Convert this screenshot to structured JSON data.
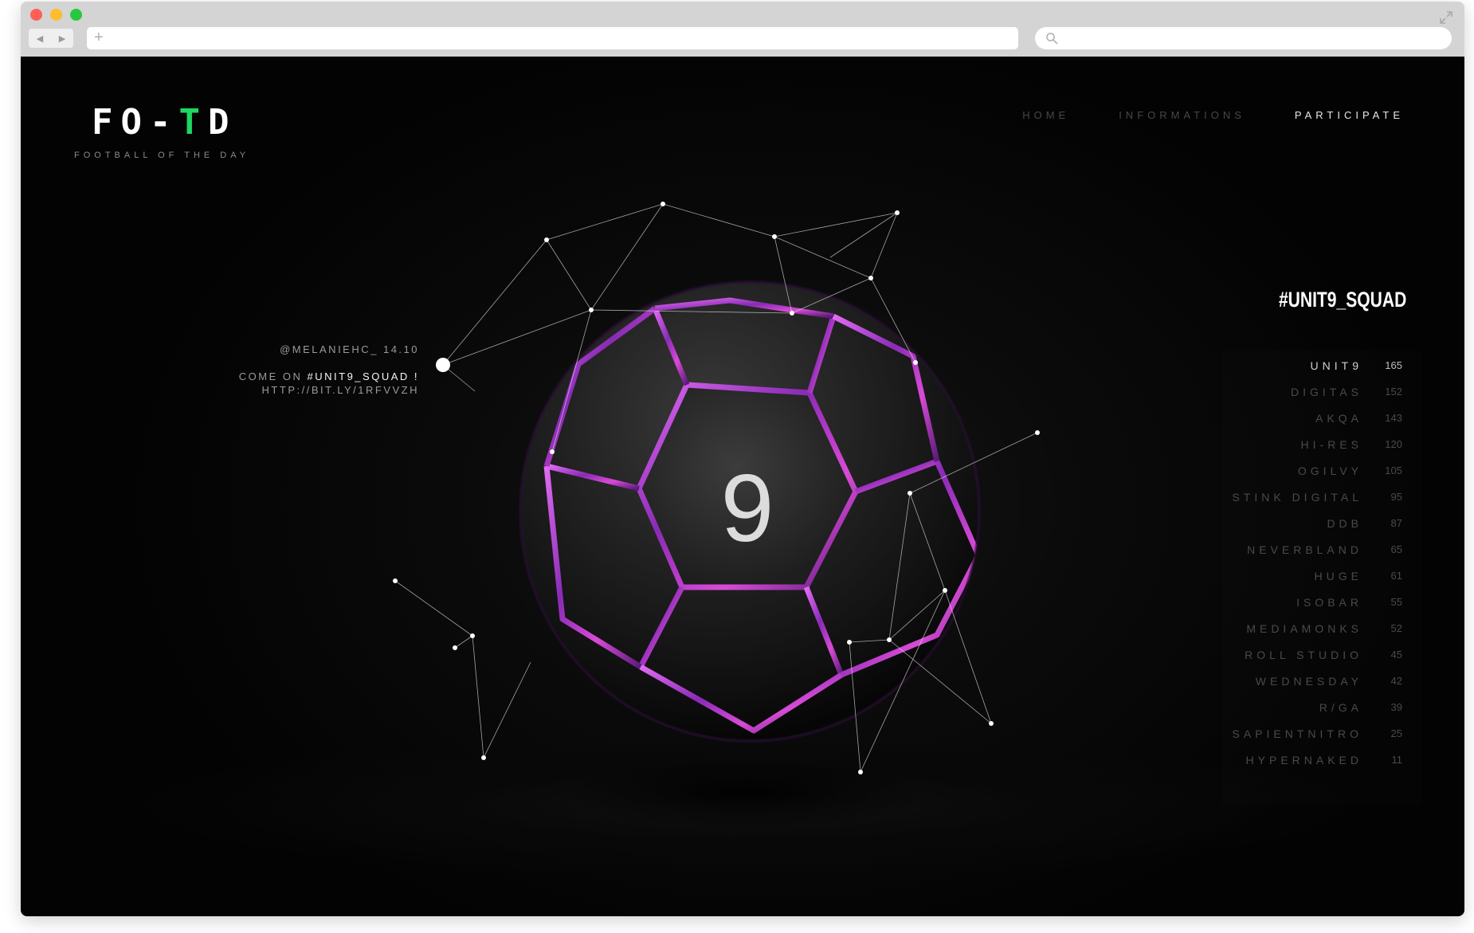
{
  "browser": {
    "back_icon": "back-arrow-icon",
    "forward_icon": "forward-arrow-icon",
    "new_tab_symbol": "+",
    "address_value": "",
    "search_value": ""
  },
  "site": {
    "logo": {
      "mark_prefix": "FO-",
      "mark_accent": "T",
      "mark_suffix": "D",
      "subtitle": "FOOTBALL OF THE DAY"
    },
    "nav": [
      {
        "label": "HOME"
      },
      {
        "label": "INFORMATIONS"
      },
      {
        "label": "PARTICIPATE"
      }
    ]
  },
  "tweet": {
    "handle": "@MELANIEHC_ 14.10",
    "text_prefix": "COME ON ",
    "hashtag": "#UNIT9_SQUAD !",
    "link": "HTTP://BIT.LY/1RFVVZH"
  },
  "ball": {
    "number": "9"
  },
  "leaderboard": {
    "title": "#UNIT9_SQUAD",
    "rows": [
      {
        "name": "UNIT9",
        "value": "165"
      },
      {
        "name": "DIGITAS",
        "value": "152"
      },
      {
        "name": "AKQA",
        "value": "143"
      },
      {
        "name": "HI-RES",
        "value": "120"
      },
      {
        "name": "OGILVY",
        "value": "105"
      },
      {
        "name": "STINK DIGITAL",
        "value": "95"
      },
      {
        "name": "DDB",
        "value": "87"
      },
      {
        "name": "NEVERBLAND",
        "value": "65"
      },
      {
        "name": "HUGE",
        "value": "61"
      },
      {
        "name": "ISOBAR",
        "value": "55"
      },
      {
        "name": "MEDIAMONKS",
        "value": "52"
      },
      {
        "name": "ROLL STUDIO",
        "value": "45"
      },
      {
        "name": "WEDNESDAY",
        "value": "42"
      },
      {
        "name": "R/GA",
        "value": "39"
      },
      {
        "name": "SAPIENTNITRO",
        "value": "25"
      },
      {
        "name": "HYPERNAKED",
        "value": "11"
      }
    ]
  },
  "colors": {
    "accent": "#1ed760",
    "ball_seam_glow": "#c02bd0",
    "background": "#050505"
  }
}
